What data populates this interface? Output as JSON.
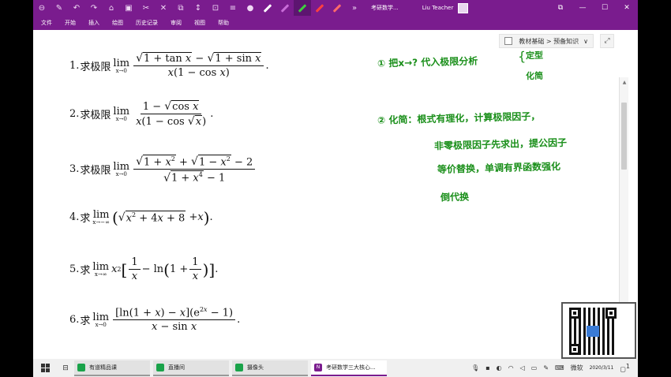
{
  "toolbar": {
    "document_title": "考研数学...",
    "user_name": "Liu Teacher",
    "restore_symbol": "⧉",
    "minimize_symbol": "—",
    "maximize_symbol": "☐",
    "close_symbol": "✕"
  },
  "menu": [
    "文件",
    "开始",
    "插入",
    "绘图",
    "历史记录",
    "审阅",
    "视图",
    "帮助"
  ],
  "breadcrumb": {
    "text": "教材基础 > 预备知识",
    "chevron": "∨",
    "expand_symbol": "⤢"
  },
  "problems": [
    {
      "number": "1.",
      "prefix": "求极限",
      "lim": "lim",
      "sub": "x→0",
      "tail": "."
    },
    {
      "number": "2.",
      "prefix": "求极限",
      "lim": "lim",
      "sub": "x→0",
      "tail": "."
    },
    {
      "number": "3.",
      "prefix": "求极限",
      "lim": "lim",
      "sub": "x→0",
      "tail": ""
    },
    {
      "number": "4.",
      "prefix": "求",
      "lim": "lim",
      "sub": "x→−∞",
      "tail": "."
    },
    {
      "number": "5.",
      "prefix": "求",
      "lim": "lim",
      "sub": "x→∞",
      "tail": "."
    },
    {
      "number": "6.",
      "prefix": "求",
      "lim": "lim",
      "sub": "x→0",
      "tail": "."
    }
  ],
  "notes": {
    "n1": "① 把x→? 代入极限分析",
    "n1a": "定型",
    "n1b": "化简",
    "n2": "② 化简：根式有理化，计算极限因子，",
    "n3": "非零极限因子先求出，提公因子",
    "n4": "等价替换，单调有界函数强化",
    "n5": "倒代换"
  },
  "taskbar": {
    "tasks": [
      {
        "label": "有道精品课",
        "color": "#1aa34a"
      },
      {
        "label": "直播间",
        "color": "#1aa34a"
      },
      {
        "label": "摄像头",
        "color": "#1aa34a"
      },
      {
        "label": "考研数学三大核心...",
        "color": "#7a1c8e"
      }
    ],
    "ime": "微软",
    "date": "2020/3/11",
    "notification_count": "1"
  }
}
